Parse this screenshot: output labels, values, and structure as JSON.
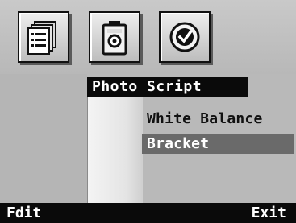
{
  "toolbar": {
    "icons": [
      "script-list-icon",
      "camera-icon",
      "check-circle-icon"
    ]
  },
  "menu": {
    "title": "Photo Script",
    "items": [
      {
        "label": "White Balance",
        "selected": false
      },
      {
        "label": "Bracket",
        "selected": true
      }
    ]
  },
  "softkeys": {
    "left": "Fdit",
    "right": "Exit"
  },
  "colors": {
    "background": "#b9b9b9",
    "title_bar": "#0a0a0a",
    "selection": "#6a6a6a",
    "softkey_bar": "#0a0a0a",
    "text_on_dark": "#ffffff"
  }
}
